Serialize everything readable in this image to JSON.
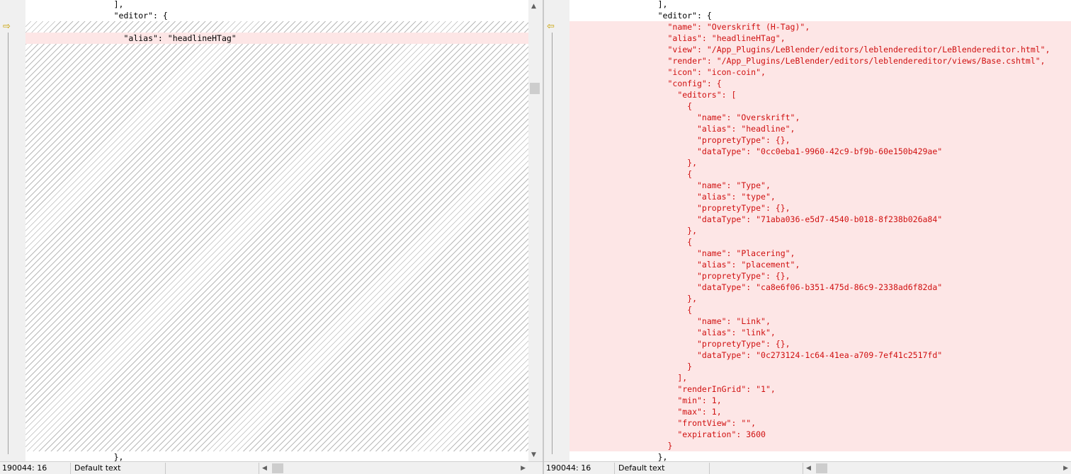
{
  "left_pane": {
    "arrow_icon": "arrow-right-icon",
    "lines": [
      "                  ],",
      "                  \"editor\": {",
      "",
      "                    \"alias\": \"headlineHTag\"",
      "                  },"
    ]
  },
  "right_pane": {
    "arrow_icon": "arrow-left-icon",
    "lines_top": [
      "                  ],",
      "                  \"editor\": {"
    ],
    "lines_diff": [
      "                    \"name\": \"Overskrift (H-Tag)\",",
      "                    \"alias\": \"headlineHTag\",",
      "                    \"view\": \"/App_Plugins/LeBlender/editors/leblendereditor/LeBlendereditor.html\",",
      "                    \"render\": \"/App_Plugins/LeBlender/editors/leblendereditor/views/Base.cshtml\",",
      "                    \"icon\": \"icon-coin\",",
      "                    \"config\": {",
      "                      \"editors\": [",
      "                        {",
      "                          \"name\": \"Overskrift\",",
      "                          \"alias\": \"headline\",",
      "                          \"propretyType\": {},",
      "                          \"dataType\": \"0cc0eba1-9960-42c9-bf9b-60e150b429ae\"",
      "                        },",
      "                        {",
      "                          \"name\": \"Type\",",
      "                          \"alias\": \"type\",",
      "                          \"propretyType\": {},",
      "                          \"dataType\": \"71aba036-e5d7-4540-b018-8f238b026a84\"",
      "                        },",
      "                        {",
      "                          \"name\": \"Placering\",",
      "                          \"alias\": \"placement\",",
      "                          \"propretyType\": {},",
      "                          \"dataType\": \"ca8e6f06-b351-475d-86c9-2338ad6f82da\"",
      "                        },",
      "                        {",
      "                          \"name\": \"Link\",",
      "                          \"alias\": \"link\",",
      "                          \"propretyType\": {},",
      "                          \"dataType\": \"0c273124-1c64-41ea-a709-7ef41c2517fd\"",
      "                        }",
      "                      ],",
      "                      \"renderInGrid\": \"1\",",
      "                      \"min\": 1,",
      "                      \"max\": 1,",
      "                      \"frontView\": \"\",",
      "                      \"expiration\": 3600",
      "                    }"
    ],
    "lines_bottom": [
      "                  },"
    ]
  },
  "status": {
    "left_position": "190044: 16",
    "left_encoding": "Default text",
    "right_position": "190044: 16",
    "right_encoding": "Default text"
  },
  "colors": {
    "diff_background": "#fde6e6",
    "diff_text": "#d01010",
    "gutter_arrow": "#c8a000"
  }
}
